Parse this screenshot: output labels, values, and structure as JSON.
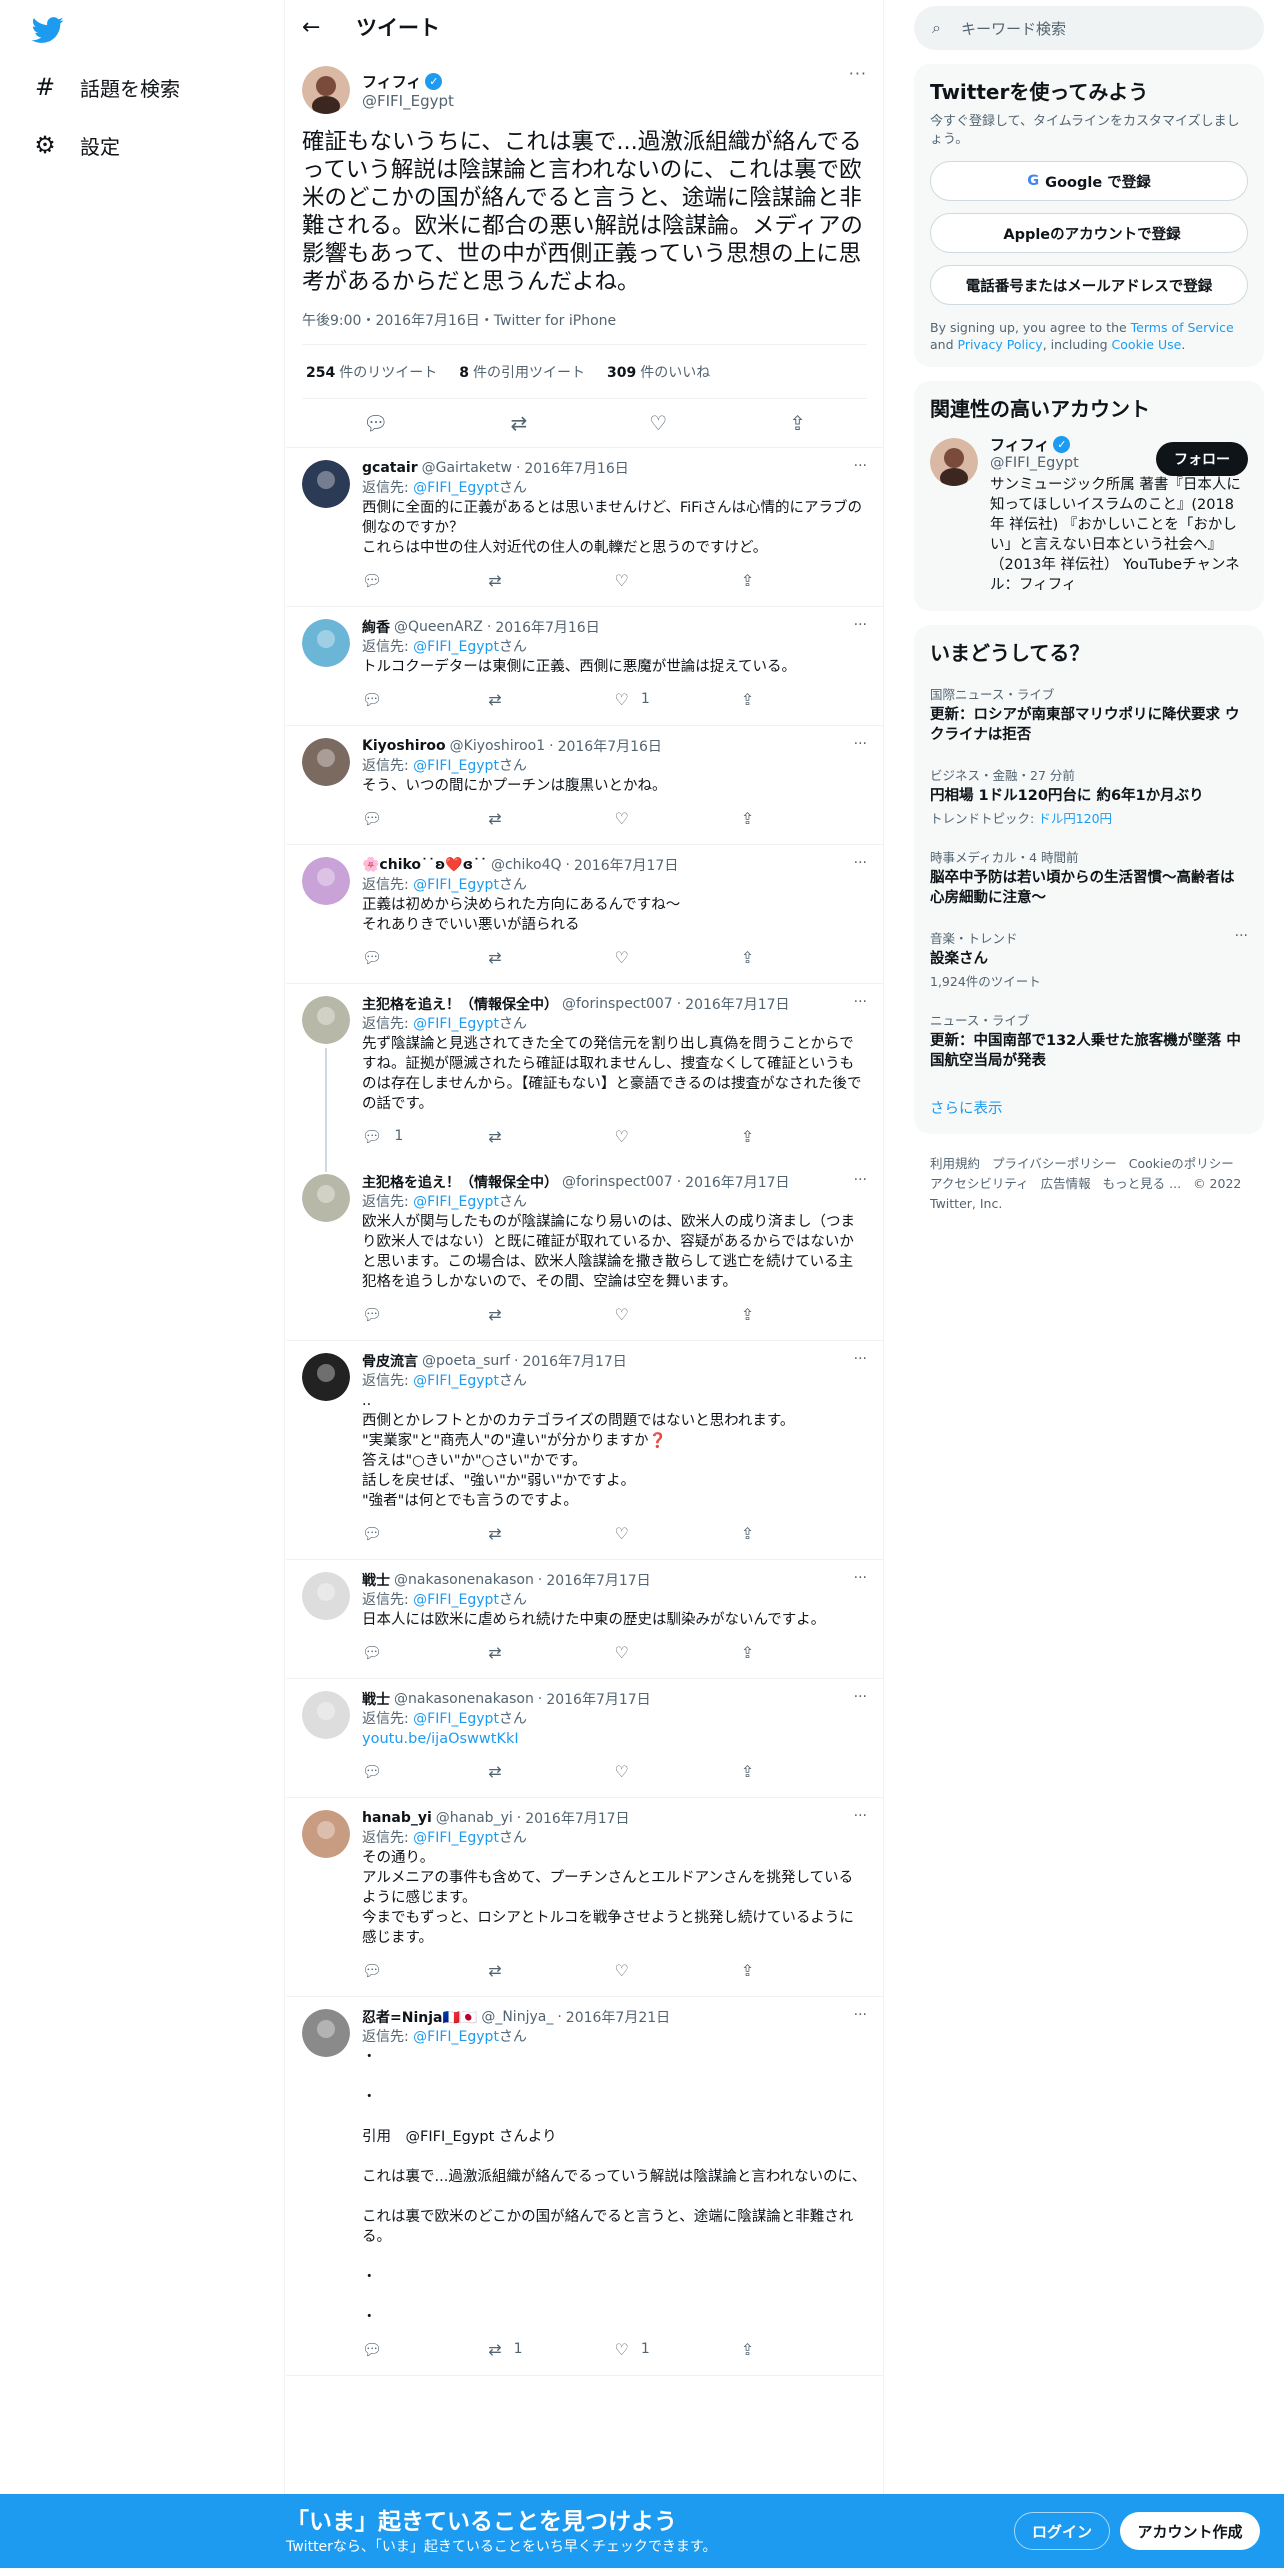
{
  "nav": {
    "explore_label": "話題を検索",
    "settings_label": "設定"
  },
  "header": {
    "title": "ツイート"
  },
  "focus_tweet": {
    "name": "フィフィ",
    "handle": "@FIFI_Egypt",
    "text": "確証もないうちに、これは裏で...過激派組織が絡んでるっていう解説は陰謀論と言われないのに、これは裏で欧米のどこかの国が絡んでると言うと、途端に陰謀論と非難される。欧米に都合の悪い解説は陰謀論。メディアの影響もあって、世の中が西側正義っていう思想の上に思考があるからだと思うんだよね。",
    "meta": "午後9:00・2016年7月16日・Twitter for iPhone",
    "retweets_count": "254",
    "retweets_label": "件のリツイート",
    "quotes_count": "8",
    "quotes_label": "件の引用ツイート",
    "likes_count": "309",
    "likes_label": "件のいいね"
  },
  "reply_to_prefix": "返信先: ",
  "reply_to_handle": "@FIFI_Egypt",
  "reply_to_suffix": "さん",
  "replies": [
    {
      "name": "gcatair",
      "handle": "@Gairtaketw",
      "date": "2016年7月16日",
      "text": "西側に全面的に正義があるとは思いませんけど、FiFiさんは心情的にアラブの側なのですか？\nこれらは中世の住人対近代の住人の軋轢だと思うのですけど。",
      "retweets": "",
      "likes": "",
      "thread": false
    },
    {
      "name": "絢香",
      "handle": "@QueenARZ",
      "date": "2016年7月16日",
      "text": "トルコクーデターは東側に正義、西側に悪魔が世論は捉えている。",
      "retweets": "",
      "likes": "1",
      "thread": false
    },
    {
      "name": "Kiyoshiroo",
      "handle": "@Kiyoshiroo1",
      "date": "2016年7月16日",
      "text": "そう、いつの間にかプーチンは腹黒いとかね。",
      "retweets": "",
      "likes": "",
      "thread": false
    },
    {
      "name": "🌸chiko˙˙ʚ❤️ɞ˙˙",
      "handle": "@chiko4Q",
      "date": "2016年7月17日",
      "text": "正義は初めから決められた方向にあるんですね〜\nそれありきでいい悪いが語られる",
      "retweets": "",
      "likes": "",
      "thread": false
    },
    {
      "name": "主犯格を追え！（情報保全中）",
      "handle": "@forinspect007",
      "date": "2016年7月17日",
      "text": "先ず陰謀論と見逃されてきた全ての発信元を割り出し真偽を問うことからですね。証拠が隠滅されたら確証は取れませんし、捜査なくして確証というものは存在しませんから。【確証もない】と豪語できるのは捜査がなされた後での話です。",
      "retweets": "",
      "likes": "",
      "replies_count": "1",
      "thread": true
    },
    {
      "name": "主犯格を追え！（情報保全中）",
      "handle": "@forinspect007",
      "date": "2016年7月17日",
      "text": "欧米人が関与したものが陰謀論になり易いのは、欧米人の成り済まし（つまり欧米人ではない）と既に確証が取れているか、容疑があるからではないかと思います。この場合は、欧米人陰謀論を撒き散らして逃亡を続けている主犯格を追うしかないので、その間、空論は空を舞います。",
      "retweets": "",
      "likes": "",
      "thread": false
    },
    {
      "name": "骨皮流言",
      "handle": "@poeta_surf",
      "date": "2016年7月17日",
      "text": "..\n西側とかレフトとかのカテゴライズの問題ではないと思われます。\n\"実業家\"と\"商売人\"の\"違い\"が分かりますか❓\n答えは\"○きい\"か\"○さい\"かです。\n話しを戻せば、\"強い\"か\"弱い\"かですよ。\n\"強者\"は何とでも言うのですよ。",
      "retweets": "",
      "likes": "",
      "thread": false
    },
    {
      "name": "戦士",
      "handle": "@nakasonenakason",
      "date": "2016年7月17日",
      "text": "日本人には欧米に虐められ続けた中東の歴史は馴染みがないんですよ。",
      "retweets": "",
      "likes": "",
      "thread": false
    },
    {
      "name": "戦士",
      "handle": "@nakasonenakason",
      "date": "2016年7月17日",
      "text": "",
      "link": "youtu.be/ijaOswwtKkI",
      "retweets": "",
      "likes": "",
      "thread": false
    },
    {
      "name": "hanab_yi",
      "handle": "@hanab_yi",
      "date": "2016年7月17日",
      "text": "その通り。\nアルメニアの事件も含めて、プーチンさんとエルドアンさんを挑発しているように感じます。\n今までもずっと、ロシアとトルコを戦争させようと挑発し続けているように感じます。",
      "retweets": "",
      "likes": "",
      "thread": false
    },
    {
      "name": "忍者=Ninja🇫🇷🇯🇵",
      "handle": "@_Ninjya_",
      "date": "2016年7月21日",
      "text": "・\n\n・\n\n引用　@FIFI_Egypt さんより\n\nこれは裏で...過激派組織が絡んでるっていう解説は陰謀論と言われないのに、\n\nこれは裏で欧米のどこかの国が絡んでると言うと、途端に陰謀論と非難される。\n\n・\n\n・",
      "retweets": "1",
      "likes": "1",
      "thread": false
    }
  ],
  "search": {
    "placeholder": "キーワード検索"
  },
  "signup_card": {
    "title": "Twitterを使ってみよう",
    "subtitle": "今すぐ登録して、タイムラインをカスタマイズしましょう。",
    "google_label": "Google で登録",
    "apple_label": "Appleのアカウントで登録",
    "phone_label": "電話番号またはメールアドレスで登録",
    "terms_prefix": "By signing up, you agree to the ",
    "terms_link": "Terms of Service",
    "terms_and": " and ",
    "privacy_link": "Privacy Policy",
    "terms_including": ", including ",
    "cookie_link": "Cookie Use",
    "terms_end": "."
  },
  "relevant": {
    "title": "関連性の高いアカウント",
    "name": "フィフィ",
    "handle": "@FIFI_Egypt",
    "follow_label": "フォロー",
    "description": "サンミュージック所属 著書『日本人に知ってほしいイスラムのこと』(2018年 祥伝社) 『おかしいことを「おかしい」と言えない日本という社会へ』（2013年 祥伝社） YouTubeチャンネル：フィフィ"
  },
  "trends": {
    "title": "いまどうしてる？",
    "items": [
      {
        "category": "国際ニュース・ライブ",
        "title": "更新：ロシアが南東部マリウポリに降伏要求 ウクライナは拒否",
        "sub": ""
      },
      {
        "category": "ビジネス・金融・27 分前",
        "title": "円相場 1ドル120円台に 約6年1か月ぶり",
        "sub_prefix": "トレンドトピック: ",
        "sub": "ドル円120円"
      },
      {
        "category": "時事メディカル・4 時間前",
        "title": "脳卒中予防は若い頃からの生活習慣～高齢者は心房細動に注意～",
        "sub": ""
      },
      {
        "category": "音楽・トレンド",
        "title": "設楽さん",
        "sub": "1,924件のツイート"
      },
      {
        "category": "ニュース・ライブ",
        "title": "更新：中国南部で132人乗せた旅客機が墜落 中国航空当局が発表",
        "sub": ""
      }
    ],
    "show_more": "さらに表示"
  },
  "footer": {
    "links": [
      "利用規約",
      "プライバシーポリシー",
      "Cookieのポリシー",
      "アクセシビリティ",
      "広告情報",
      "もっと見る ..."
    ],
    "copyright": "© 2022 Twitter, Inc."
  },
  "bottom_bar": {
    "title": "「いま」起きていることを見つけよう",
    "subtitle": "Twitterなら、「いま」起きていることをいち早くチェックできます。",
    "login_label": "ログイン",
    "signup_label": "アカウント作成"
  },
  "colors": {
    "brand": "#1d9bf0",
    "text": "#0f1419",
    "secondary": "#536471"
  }
}
